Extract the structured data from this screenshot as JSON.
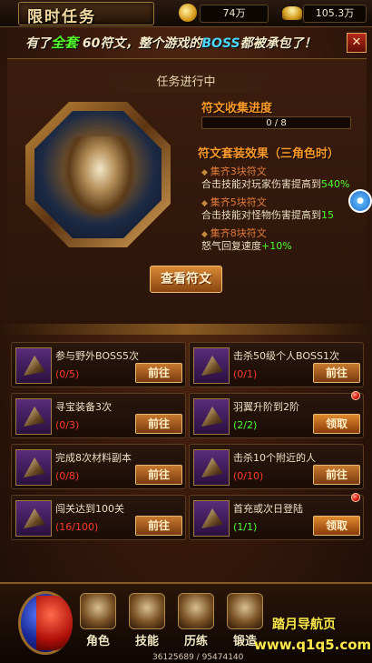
{
  "header": {
    "title": "限时任务",
    "gold_amount": "74万",
    "ingot_amount": "105.3万"
  },
  "banner": {
    "part1": "有了",
    "highlight1": "全套",
    "part2": " 60符文，整个游戏的",
    "highlight2": "BOSS",
    "part3": "都被承包了！"
  },
  "main": {
    "status": "任务进行中",
    "progress_title": "符文收集进度",
    "progress_value": 0,
    "progress_max": 8,
    "progress_text": "0 / 8",
    "set_title": "符文套装效果（三角色时）",
    "sets": [
      {
        "name": "集齐3块符文",
        "desc": "合击技能对玩家伤害提高到",
        "value": "540%"
      },
      {
        "name": "集齐5块符文",
        "desc": "合击技能对怪物伤害提高到",
        "value": "15"
      },
      {
        "name": "集齐8块符文",
        "desc": "怒气回复速度",
        "value": "+10%"
      }
    ],
    "view_button": "查看符文"
  },
  "tasks": [
    {
      "name": "参与野外BOSS5次",
      "progress": "(0/5)",
      "button": "前往",
      "done": false
    },
    {
      "name": "击杀50级个人BOSS1次",
      "progress": "(0/1)",
      "button": "前往",
      "done": false
    },
    {
      "name": "寻宝装备3次",
      "progress": "(0/3)",
      "button": "前往",
      "done": false
    },
    {
      "name": "羽翼升阶到2阶",
      "progress": "(2/2)",
      "button": "领取",
      "done": true
    },
    {
      "name": "完成8次材料副本",
      "progress": "(0/8)",
      "button": "前往",
      "done": false
    },
    {
      "name": "击杀10个附近的人",
      "progress": "(0/10)",
      "button": "前往",
      "done": false
    },
    {
      "name": "闯关达到100关",
      "progress": "(16/100)",
      "button": "前往",
      "done": false
    },
    {
      "name": "首充或次日登陆",
      "progress": "(1/1)",
      "button": "领取",
      "done": true
    }
  ],
  "bottom_nav": {
    "items": [
      {
        "label": "角色",
        "icon": "warrior-icon"
      },
      {
        "label": "技能",
        "icon": "skill-icon"
      },
      {
        "label": "历练",
        "icon": "training-icon"
      },
      {
        "label": "锻造",
        "icon": "forge-icon"
      }
    ],
    "exp_text": "36125689 / 95474140"
  },
  "watermark": {
    "line1": "踏月导航页",
    "line2": "www.q1q5.com"
  },
  "colors": {
    "accent_orange": "#ff9a2a",
    "progress_red": "#ff3a2a",
    "progress_green": "#4bff2a",
    "button_gold": "#c77a2e"
  }
}
